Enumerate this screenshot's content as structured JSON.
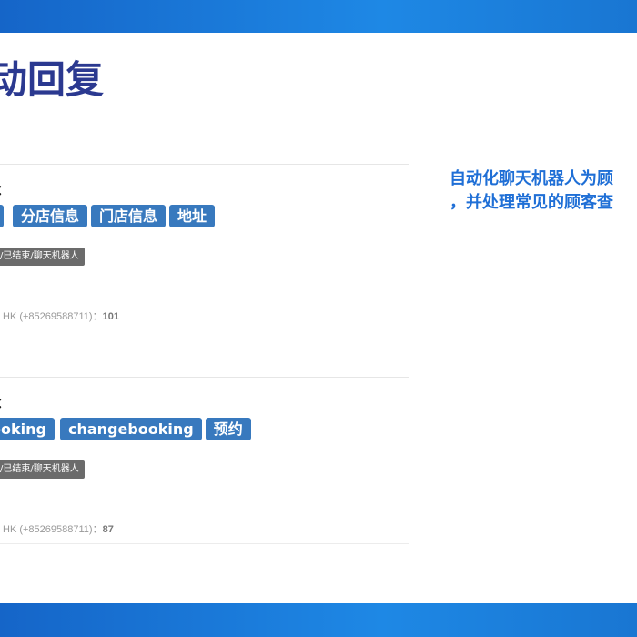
{
  "slide": {
    "title": "动回复",
    "side_note_line1": "自动化聊天机器人为顾",
    "side_note_line2": "，并处理常见的顾客查"
  },
  "entries": [
    {
      "label": "：",
      "tags": [
        "",
        "分店信息",
        "门店信息",
        "地址"
      ],
      "status": "/已结束/聊天机器人",
      "meta_prefix": "HK (+85269588711)：",
      "meta_count": "101"
    },
    {
      "label": "：",
      "tags": [
        "ooking",
        "changebooking",
        "预约"
      ],
      "status": "/已结束/聊天机器人",
      "meta_prefix": "HK (+85269588711)：",
      "meta_count": "87"
    }
  ],
  "colors": {
    "frame": "#1e88e5",
    "title": "#2b3990",
    "accent_text": "#1f6fd6",
    "tag_bg": "#3879be",
    "status_bg": "#6b6b6b"
  }
}
